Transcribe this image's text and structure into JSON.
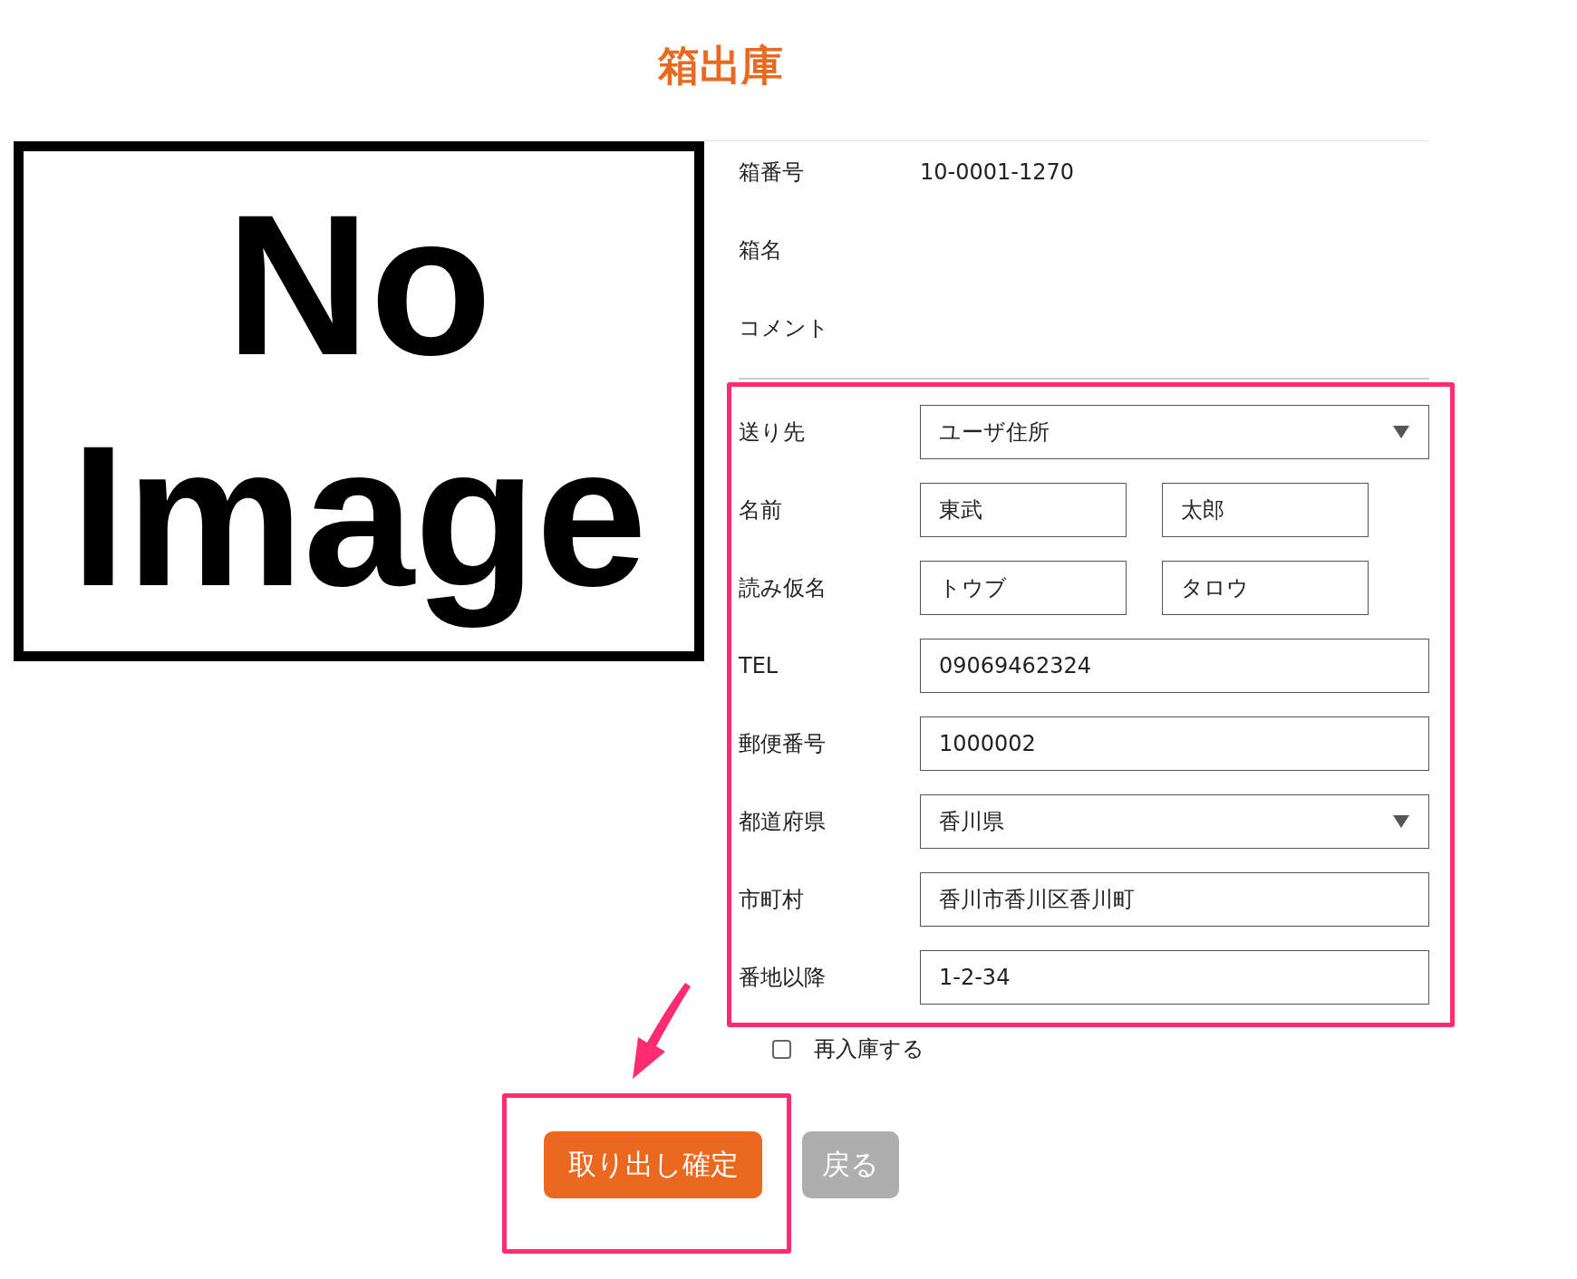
{
  "title": "箱出庫",
  "image": {
    "text": "No Image"
  },
  "info": [
    {
      "label": "箱番号",
      "value": "10-0001-1270"
    },
    {
      "label": "箱名"
    },
    {
      "label": "コメント"
    }
  ],
  "address": [
    {
      "kind": "select",
      "label": "送り先",
      "values": [
        "ユーザ住所"
      ]
    },
    {
      "kind": "pair",
      "label": "名前",
      "values": [
        "東武",
        "太郎"
      ]
    },
    {
      "kind": "pair",
      "label": "読み仮名",
      "values": [
        "トウブ",
        "タロウ"
      ]
    },
    {
      "kind": "text",
      "label": "TEL",
      "values": [
        "09069462324"
      ]
    },
    {
      "kind": "text",
      "label": "郵便番号",
      "values": [
        "1000002"
      ]
    },
    {
      "kind": "select",
      "label": "都道府県",
      "values": [
        "香川県"
      ]
    },
    {
      "kind": "text",
      "label": "市町村",
      "values": [
        "香川市香川区香川町"
      ]
    },
    {
      "kind": "text",
      "label": "番地以降",
      "values": [
        "1-2-34"
      ]
    }
  ],
  "restock": {
    "label": "再入庫する",
    "checked": false
  },
  "buttons": [
    {
      "label": "取り出し確定",
      "kind": "primary"
    },
    {
      "label": "戻る",
      "kind": "secondary"
    }
  ]
}
